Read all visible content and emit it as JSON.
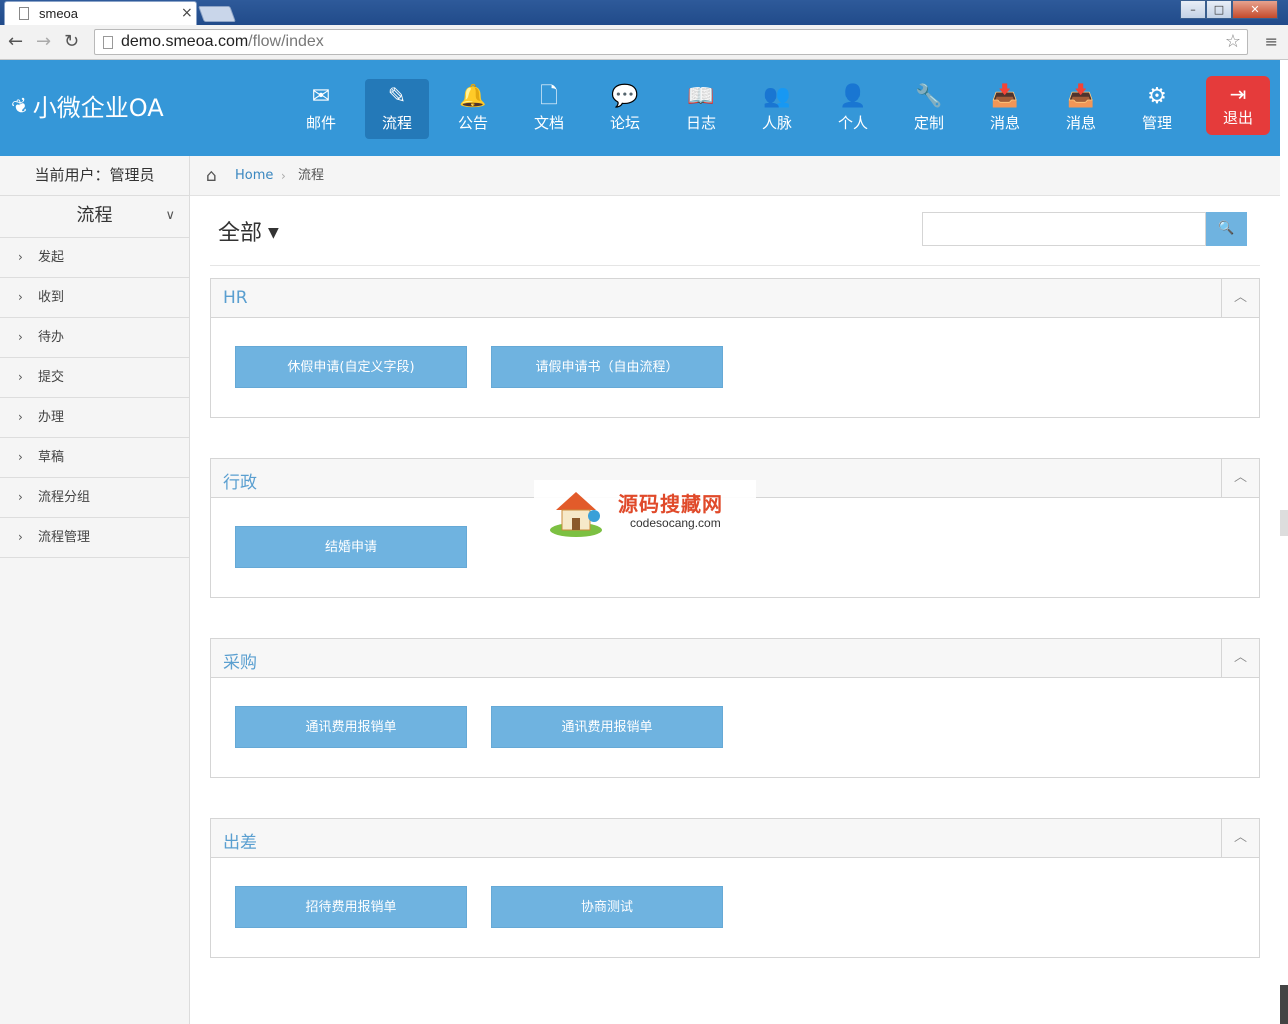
{
  "browser": {
    "tab_title": "smeoa",
    "tab_close": "×",
    "url_host": "demo.smeoa.com",
    "url_path": "/flow/index",
    "win_min": "–",
    "win_max": "□",
    "win_close": "✕",
    "nav_back": "←",
    "nav_forward": "→",
    "nav_reload": "↻",
    "star": "☆",
    "menu": "≡"
  },
  "header": {
    "logo_text": "小微企业OA",
    "nav": [
      {
        "label": "邮件",
        "icon": "envelope-icon",
        "glyph": "✉"
      },
      {
        "label": "流程",
        "icon": "pencil-icon",
        "glyph": "✎"
      },
      {
        "label": "公告",
        "icon": "bell-icon",
        "glyph": "🔔"
      },
      {
        "label": "文档",
        "icon": "document-icon",
        "glyph": "🗋"
      },
      {
        "label": "论坛",
        "icon": "comments-icon",
        "glyph": "💬"
      },
      {
        "label": "日志",
        "icon": "book-icon",
        "glyph": "📖"
      },
      {
        "label": "人脉",
        "icon": "users-icon",
        "glyph": "👥"
      },
      {
        "label": "个人",
        "icon": "user-icon",
        "glyph": "👤"
      },
      {
        "label": "定制",
        "icon": "wrench-icon",
        "glyph": "🔧"
      },
      {
        "label": "消息",
        "icon": "inbox-icon",
        "glyph": "📥"
      },
      {
        "label": "消息",
        "icon": "inbox-icon",
        "glyph": "📥"
      },
      {
        "label": "管理",
        "icon": "gears-icon",
        "glyph": "⚙"
      }
    ],
    "logout_label": "退出",
    "logout_glyph": "⇥"
  },
  "sidebar": {
    "current_user": "当前用户：管理员",
    "section_title": "流程",
    "section_chevron": "∨",
    "items": [
      {
        "label": "发起"
      },
      {
        "label": "收到"
      },
      {
        "label": "待办"
      },
      {
        "label": "提交"
      },
      {
        "label": "办理"
      },
      {
        "label": "草稿"
      },
      {
        "label": "流程分组"
      },
      {
        "label": "流程管理"
      }
    ],
    "item_arrow": "›"
  },
  "breadcrumb": {
    "home": "Home",
    "separator": "›",
    "current": "流程"
  },
  "filter": {
    "label": "全部",
    "caret": "▼"
  },
  "search": {
    "placeholder": "",
    "button_glyph": "🔍"
  },
  "groups": [
    {
      "title": "HR",
      "buttons": [
        "休假申请(自定义字段)",
        "请假申请书（自由流程）"
      ]
    },
    {
      "title": "行政",
      "buttons": [
        "结婚申请"
      ]
    },
    {
      "title": "采购",
      "buttons": [
        "通讯费用报销单",
        "通讯费用报销单"
      ]
    },
    {
      "title": "出差",
      "buttons": [
        "招待费用报销单",
        "协商测试"
      ]
    }
  ],
  "group_toggle": "︿",
  "watermark": {
    "text": "源码搜藏网",
    "sub": "codesocang.com"
  }
}
